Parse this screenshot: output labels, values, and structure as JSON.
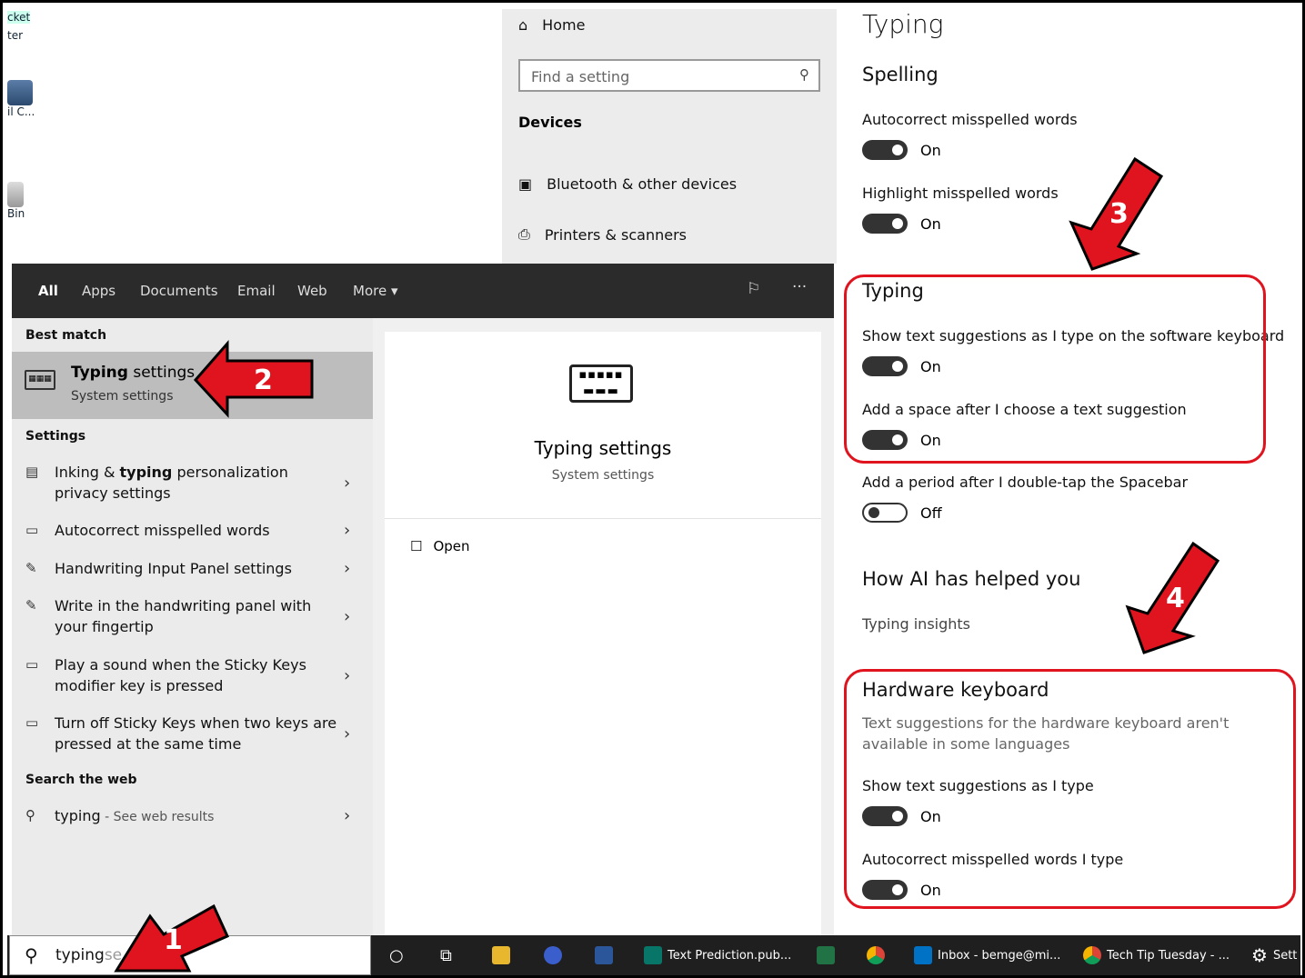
{
  "desktop": {
    "icons": [
      {
        "label": "cket"
      },
      {
        "label": "ter"
      },
      {
        "label": "il C..."
      },
      {
        "label": "Bin"
      }
    ]
  },
  "nav": {
    "home": "Home",
    "search_placeholder": "Find a setting",
    "section": "Devices",
    "items": [
      "Bluetooth & other devices",
      "Printers & scanners"
    ]
  },
  "pane": {
    "title": "Typing",
    "spelling": "Spelling",
    "autocorrect": {
      "label": "Autocorrect misspelled words",
      "state": "On"
    },
    "highlight": {
      "label": "Highlight misspelled words",
      "state": "On"
    },
    "typing_header": "Typing",
    "show_suggestions": {
      "label": "Show text suggestions as I type on the software keyboard",
      "state": "On"
    },
    "add_space": {
      "label": "Add a space after I choose a text suggestion",
      "state": "On"
    },
    "add_period": {
      "label": "Add a period after I double-tap the Spacebar",
      "state": "Off"
    },
    "ai_header": "How AI has helped you",
    "insights": "Typing insights",
    "hw_header": "Hardware keyboard",
    "hw_note": "Text suggestions for the hardware keyboard aren't available in some languages",
    "hw_show": {
      "label": "Show text suggestions as I type",
      "state": "On"
    },
    "hw_autocorrect": {
      "label": "Autocorrect misspelled words I type",
      "state": "On"
    }
  },
  "start": {
    "tabs": [
      "All",
      "Apps",
      "Documents",
      "Email",
      "Web",
      "More"
    ],
    "best_match_header": "Best match",
    "best_match": {
      "title_pre": "Typing",
      "title_post": " settings",
      "subtitle": "System settings"
    },
    "settings_header": "Settings",
    "results": [
      {
        "pre": "Inking & ",
        "bold": "typing",
        "post": " personalization privacy settings",
        "icon": "clipboard-icon"
      },
      {
        "pre": "Autocorrect misspelled words",
        "bold": "",
        "post": "",
        "icon": "keyboard-icon"
      },
      {
        "pre": "Handwriting Input Panel settings",
        "bold": "",
        "post": "",
        "icon": "pen-icon"
      },
      {
        "pre": "Write in the handwriting panel with your fingertip",
        "bold": "",
        "post": "",
        "icon": "pen-icon"
      },
      {
        "pre": "Play a sound when the Sticky Keys modifier key is pressed",
        "bold": "",
        "post": "",
        "icon": "keyboard-icon"
      },
      {
        "pre": "Turn off Sticky Keys when two keys are pressed at the same time",
        "bold": "",
        "post": "",
        "icon": "keyboard-icon"
      }
    ],
    "web_header": "Search the web",
    "web_result": {
      "term": "typing",
      "suffix": " - See web results"
    },
    "preview": {
      "title": "Typing settings",
      "subtitle": "System settings",
      "open": "Open"
    }
  },
  "taskbar": {
    "search_text": "typing",
    "search_trailing": "se",
    "apps": [
      {
        "label": "Text Prediction.pub...",
        "icon": "publisher-icon"
      },
      {
        "label": "Inbox - bemge@mi...",
        "icon": "outlook-icon"
      },
      {
        "label": "Tech Tip Tuesday - ...",
        "icon": "chrome-icon"
      },
      {
        "label": "Sett",
        "icon": "gear-icon"
      }
    ]
  },
  "callouts": [
    "1",
    "2",
    "3",
    "4"
  ],
  "colors": {
    "callout_red": "#e0141e",
    "toggle_on": "#333333",
    "taskbar": "#1f1f1f"
  }
}
